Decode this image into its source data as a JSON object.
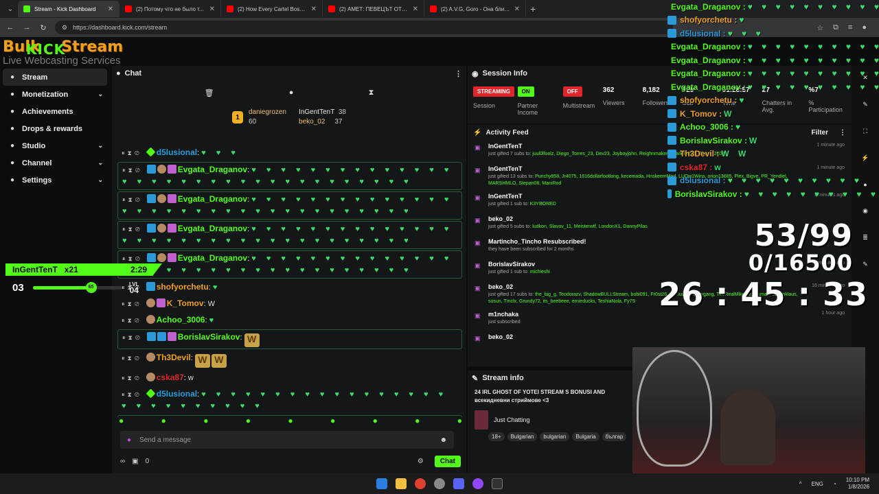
{
  "browser": {
    "tabs": [
      {
        "label": "Stream - Kick Dashboard",
        "color": "#53fc18",
        "active": true
      },
      {
        "label": "(2) Потому что не было т...",
        "color": "#ff0000"
      },
      {
        "label": "(2) How Every Cartel Boss Died",
        "color": "#ff0000"
      },
      {
        "label": "(2) АМЕТ: ПЕВЕЦЪТ ОТ НАРОД...",
        "color": "#ff0000"
      },
      {
        "label": "(2) A.V.G, Goro - Она близко (...",
        "color": "#ff0000"
      }
    ],
    "url": "https://dashboard.kick.com/stream"
  },
  "logo": {
    "top": "Bulk",
    "kick": "KICK",
    "stream": "Stream",
    "sub": "Live Webcasting Services"
  },
  "sidebar": {
    "items": [
      {
        "label": "Stream",
        "icon": "broadcast-icon"
      },
      {
        "label": "Monetization",
        "icon": "dollar-icon",
        "chevron": "⌄"
      },
      {
        "label": "Achievements",
        "icon": "trophy-icon"
      },
      {
        "label": "Drops & rewards",
        "icon": "gift-icon"
      },
      {
        "label": "Studio",
        "icon": "studio-icon",
        "chevron": "⌄"
      },
      {
        "label": "Channel",
        "icon": "person-icon",
        "chevron": "⌄"
      },
      {
        "label": "Settings",
        "icon": "gear-icon",
        "chevron": "⌄"
      }
    ]
  },
  "chat": {
    "title": "Chat",
    "leaderboard": [
      {
        "rank": "1",
        "name": "daniegrozen",
        "points": "60"
      },
      {
        "name": "InGentTenT",
        "points": "38"
      },
      {
        "name": "beko_02",
        "points": "37"
      }
    ],
    "messages": [
      {
        "user": "d5lusional",
        "color": "#2a9bd8",
        "badges": [
          "green"
        ],
        "text": "♥ ♥ ♥",
        "boxed": false
      },
      {
        "user": "Evgata_Draganov",
        "color": "#53fc18",
        "badges": [
          "blue",
          "face",
          "purple"
        ],
        "text": "♥ ♥ ♥ ♥ ♥ ♥ ♥ ♥ ♥ ♥ ♥ ♥ ♥ ♥ ♥ ♥ ♥ ♥ ♥ ♥ ♥ ♥ ♥ ♥ ♥ ♥ ♥ ♥ ♥ ♥ ♥ ♥ ♥ ♥",
        "boxed": true
      },
      {
        "user": "Evgata_Draganov",
        "color": "#53fc18",
        "badges": [
          "blue",
          "face",
          "purple"
        ],
        "text": "♥ ♥ ♥ ♥ ♥ ♥ ♥ ♥ ♥ ♥ ♥ ♥ ♥ ♥ ♥ ♥ ♥ ♥ ♥ ♥ ♥ ♥ ♥ ♥ ♥ ♥ ♥ ♥ ♥ ♥ ♥ ♥ ♥ ♥",
        "boxed": true
      },
      {
        "user": "Evgata_Draganov",
        "color": "#53fc18",
        "badges": [
          "blue",
          "face",
          "purple"
        ],
        "text": "♥ ♥ ♥ ♥ ♥ ♥ ♥ ♥ ♥ ♥ ♥ ♥ ♥ ♥ ♥ ♥ ♥ ♥ ♥ ♥ ♥ ♥ ♥ ♥ ♥ ♥ ♥ ♥ ♥ ♥ ♥ ♥ ♥ ♥",
        "boxed": true
      },
      {
        "user": "Evgata_Draganov",
        "color": "#53fc18",
        "badges": [
          "blue",
          "face",
          "purple"
        ],
        "text": "♥ ♥ ♥ ♥ ♥ ♥ ♥ ♥ ♥ ♥ ♥ ♥ ♥ ♥ ♥ ♥ ♥ ♥ ♥ ♥ ♥ ♥ ♥ ♥ ♥ ♥ ♥ ♥ ♥ ♥ ♥ ♥ ♥ ♥",
        "boxed": true
      },
      {
        "user": "shofyorchetu",
        "color": "#f0a020",
        "badges": [
          "blue"
        ],
        "text": "♥",
        "boxed": false
      },
      {
        "user": "K_Tomov",
        "color": "#f0a020",
        "badges": [
          "face",
          "purple"
        ],
        "text": "W",
        "boxed": false
      },
      {
        "user": "Achoo_3006",
        "color": "#53fc18",
        "badges": [
          "face"
        ],
        "text": "♥",
        "boxed": false
      },
      {
        "user": "BorislavSirakov",
        "color": "#53fc18",
        "badges": [
          "blue",
          "blue",
          "purple"
        ],
        "text": "",
        "emote": "W",
        "boxed": true
      },
      {
        "user": "Th3Devil",
        "color": "#f0a020",
        "badges": [
          "face"
        ],
        "text": "",
        "emote": "W W",
        "boxed": false
      },
      {
        "user": "cska87",
        "color": "#e0252b",
        "badges": [
          "face"
        ],
        "text": "w",
        "boxed": false
      },
      {
        "user": "d5lusional",
        "color": "#2a9bd8",
        "badges": [
          "green"
        ],
        "text": "♥ ♥ ♥ ♥ ♥ ♥ ♥ ♥ ♥ ♥ ♥ ♥ ♥ ♥ ♥ ♥ ♥ ♥ ♥ ♥ ♥ ♥ ♥ ♥ ♥ ♥ ♥",
        "boxed": false
      },
      {
        "user": "BorislavSirakov",
        "color": "#53fc18",
        "badges": [
          "blue",
          "blue",
          "purple"
        ],
        "text": "♥ ♥ ♥ ♥ ♥ ♥ ♥ ♥ ♥ ♥ ♥",
        "boxed": true
      }
    ],
    "placeholder": "Send a message",
    "count": "0",
    "send_label": "Chat"
  },
  "session": {
    "title": "Session Info",
    "stats": [
      {
        "pill": "STREAMING",
        "pill_color": "red",
        "label": "Session"
      },
      {
        "pill": "ON",
        "pill_color": "green",
        "label": "Partner Income"
      },
      {
        "pill": "OFF",
        "pill_color": "red",
        "label": "Multistream"
      },
      {
        "value": "362",
        "label": "Viewers"
      },
      {
        "value": "8,182",
        "label": "Followers"
      },
      {
        "value": "929",
        "label": "Sub"
      },
      {
        "value": "01:28:57",
        "label": "Time"
      },
      {
        "value": "27",
        "label": "Chatters in Avg."
      },
      {
        "value": "%7",
        "label": "% Participation"
      }
    ]
  },
  "activity": {
    "title": "Activity Feed",
    "filter": "Filter",
    "items": [
      {
        "name": "InGentTenT",
        "desc": "just gifted 7 subs to:",
        "list": "juul0lfoolz, Diego_Torres_23, Dev23, Joyboyjohn, Reighnmaker, Anarkny828, Ghost_2600",
        "time": "1 minute ago"
      },
      {
        "name": "InGentTenT",
        "desc": "just gifted 13 subs to:",
        "list": "Punchy858, Jr4075, 1616dollarfootlong, kecemada, HnskeemMod, LUDw1Wins, orion13685, Plex, Bigve, PR_Yendiel, MARSHMLO, Stepan08, ManiRod",
        "time": "1 minute ago"
      },
      {
        "name": "InGentTenT",
        "desc": "just gifted 1 sub to:",
        "list": "K3YBORED",
        "time": "2 minutes ago"
      },
      {
        "name": "beko_02",
        "desc": "just gifted 5 subs to:",
        "list": "ludkon, Slavov_11, Meisterwtf, LondonX1, DannyPilas",
        "time": ""
      },
      {
        "name": "Martincho_Tincho Resubscribed!",
        "desc": "they have been subscribed for 2 months",
        "list": "",
        "time": ""
      },
      {
        "name": "BorislavSirakov",
        "desc": "just gifted 1 sub to:",
        "list": "michieshi",
        "time": "15 minutes ago"
      },
      {
        "name": "beko_02",
        "desc": "just gifted 17 subs to:",
        "list": "the_big_g, Teodorazv, ShadowBULLStream, bobi091, Fr0st26, Sheluvs_yk, mvgang, TheRealMikePik, hisma1, Jasonklaus, sosun, Tmclx, Grundy72, its_beebeee, ernieducks, TeshiaNola, Fy7S",
        "time": "16 minutes ago"
      },
      {
        "name": "m1nchaka",
        "desc": "just subscribed",
        "list": "",
        "time": "1 hour ago"
      },
      {
        "name": "beko_02",
        "desc": "",
        "list": "",
        "time": ""
      }
    ]
  },
  "stream_info": {
    "title": "Stream info",
    "stream_title": "24 IRL GHOST OF YOTEI STREAM S BONUSI AND всекидневни стриймове <3",
    "category": "Just Chatting",
    "tags": [
      "18+",
      "Bulgarian",
      "bulgarian",
      "Bulgaria",
      "българ"
    ]
  },
  "overlay": {
    "chat": [
      {
        "user": "Evgata_Draganov",
        "color": "#53fc18",
        "hearts": "♥ ♥ ♥ ♥ ♥ ♥ ♥ ♥ ♥ ♥ ♥"
      },
      {
        "user": "shofyorchetu",
        "color": "#f0a020",
        "hearts": "♥"
      },
      {
        "user": "d5lusional",
        "color": "#2a9bd8",
        "hearts": "♥ ♥ ♥"
      },
      {
        "user": "Evgata_Draganov",
        "color": "#53fc18",
        "hearts": "♥ ♥ ♥ ♥ ♥ ♥ ♥ ♥ ♥ ♥ ♥"
      },
      {
        "user": "Evgata_Draganov",
        "color": "#53fc18",
        "hearts": "♥ ♥ ♥ ♥ ♥ ♥ ♥ ♥ ♥ ♥ ♥"
      },
      {
        "user": "Evgata_Draganov",
        "color": "#53fc18",
        "hearts": "♥ ♥ ♥ ♥ ♥ ♥ ♥ ♥ ♥ ♥ ♥"
      },
      {
        "user": "Evgata_Draganov",
        "color": "#53fc18",
        "hearts": "♥ ♥ ♥ ♥ ♥ ♥ ♥ ♥ ♥ ♥ ♥"
      },
      {
        "user": "shofyorchetu",
        "color": "#f0a020",
        "hearts": "♥"
      },
      {
        "user": "K_Tomov",
        "color": "#f0a020",
        "hearts": "W"
      },
      {
        "user": "Achoo_3006",
        "color": "#53fc18",
        "hearts": "♥"
      },
      {
        "user": "BorislavSirakov",
        "color": "#53fc18",
        "hearts": "W"
      },
      {
        "user": "Th3Devil",
        "color": "#f0a020",
        "hearts": "W W"
      },
      {
        "user": "cska87",
        "color": "#e0252b",
        "hearts": "w"
      },
      {
        "user": "d5lusional",
        "color": "#2a9bd8",
        "hearts": "♥ ♥ ♥ ♥ ♥ ♥ ♥ ♥ ♥ ♥"
      },
      {
        "user": "BorislavSirakov",
        "color": "#53fc18",
        "hearts": "♥ ♥ ♥ ♥ ♥ ♥ ♥ ♥ ♥ ♥"
      }
    ],
    "subs_goal": "53/99",
    "points_goal": "0/16500",
    "timer": "26 : 45 : 33"
  },
  "goal_widget": {
    "user": "InGentTenT",
    "multiplier": "x21",
    "time": "2:29",
    "level_from": "03",
    "progress": 65,
    "progress_label": "65",
    "level_label": "LVL",
    "level_to": "04"
  },
  "taskbar": {
    "lang": "ENG",
    "time": "10:10 PM",
    "date": "1/8/2026"
  }
}
